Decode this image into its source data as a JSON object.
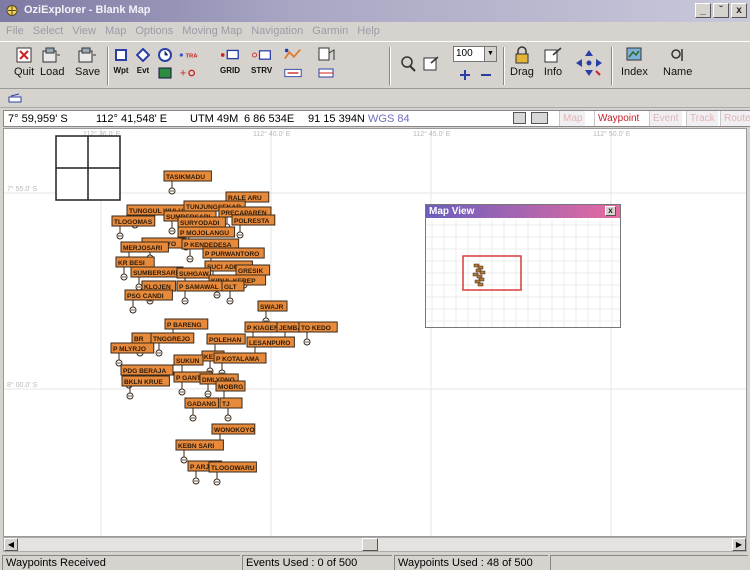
{
  "window": {
    "title": "OziExplorer - Blank Map",
    "buttons": [
      "_",
      "̆",
      "x"
    ]
  },
  "menu": [
    "File",
    "Select",
    "View",
    "Map",
    "Options",
    "Moving Map",
    "Navigation",
    "Garmin",
    "Help"
  ],
  "toolbar": {
    "quit": "Quit",
    "load": "Load",
    "save": "Save",
    "wpt": "Wpt",
    "evt": "Evt",
    "track": "TRACK",
    "grid": "GRID",
    "strv": "STRV",
    "zoom": "100",
    "drag": "Drag",
    "info": "Info",
    "index": "Index",
    "name": "Name"
  },
  "coords": {
    "lat": "7° 59,959' S",
    "lon": "112° 41,548' E",
    "utm": "UTM 49M",
    "easting": "6 86 534E",
    "northing": "91 15 394N",
    "datum": "WGS 84"
  },
  "mode_tabs": [
    "Map",
    "Waypoint",
    "Event",
    "Track",
    "Route"
  ],
  "map": {
    "lon_ticks": [
      "112° 36.0' E",
      "112° 40.0' E",
      "112° 45.0' E",
      "112° 50.0' E"
    ],
    "lat_ticks": [
      "7° 55.0' S",
      "8° 00.0' S"
    ]
  },
  "waypoints": [
    {
      "label": "TASIKMADU"
    },
    {
      "label": "RALE ARU"
    },
    {
      "label": "TUNGGUL WULUNG"
    },
    {
      "label": "TUNJUNGSEKAR"
    },
    {
      "label": "PRECAPAREN"
    },
    {
      "label": "TLOGOMAS"
    },
    {
      "label": "SUMBERSARI"
    },
    {
      "label": "SURYODADI"
    },
    {
      "label": "POLRESTA"
    },
    {
      "label": "P MOJOLANGU"
    },
    {
      "label": "P DINOYO"
    },
    {
      "label": "P KENDEDESA"
    },
    {
      "label": "MERJOSARI"
    },
    {
      "label": "P PURWANTORO"
    },
    {
      "label": "KR BESI"
    },
    {
      "label": "SUCI ADEA"
    },
    {
      "label": "GRESIK"
    },
    {
      "label": "SUMBERSARI"
    },
    {
      "label": "SUHGAW"
    },
    {
      "label": "KIDUL KEREP"
    },
    {
      "label": "KLOJEN"
    },
    {
      "label": "P SAMAWAL"
    },
    {
      "label": "GLT"
    },
    {
      "label": "PSG CANDI"
    },
    {
      "label": "SWAJR"
    },
    {
      "label": "P BARENG"
    },
    {
      "label": "P KIAGEN GRIBIG"
    },
    {
      "label": "JEMBAT"
    },
    {
      "label": "TO KEDO"
    },
    {
      "label": "BR"
    },
    {
      "label": "TNGGREJO"
    },
    {
      "label": "POLEHAN"
    },
    {
      "label": "LESANPURO"
    },
    {
      "label": "P MLYRJO"
    },
    {
      "label": "KE"
    },
    {
      "label": "P KOTALAMA"
    },
    {
      "label": "SUKUN"
    },
    {
      "label": "PDG BERAJA"
    },
    {
      "label": "P GANTI"
    },
    {
      "label": "DMLYDNO"
    },
    {
      "label": "BKLN KRUE"
    },
    {
      "label": "MOBRG"
    },
    {
      "label": "GADANG"
    },
    {
      "label": "TJ"
    },
    {
      "label": "WONOKOYO"
    },
    {
      "label": "KEBN SARI"
    },
    {
      "label": "P ARJO"
    },
    {
      "label": "TLOGOWARU"
    }
  ],
  "mapview": {
    "title": "Map View",
    "close": "x"
  },
  "status": {
    "msg": "Waypoints Received",
    "events": "Events Used : 0 of 500",
    "waypoints": "Waypoints Used : 48 of 500"
  },
  "colors": {
    "waypoint_fill": "#e78a3c",
    "waypoint_border": "#3a2a1a",
    "mapview_frame": "#d83a3a"
  }
}
